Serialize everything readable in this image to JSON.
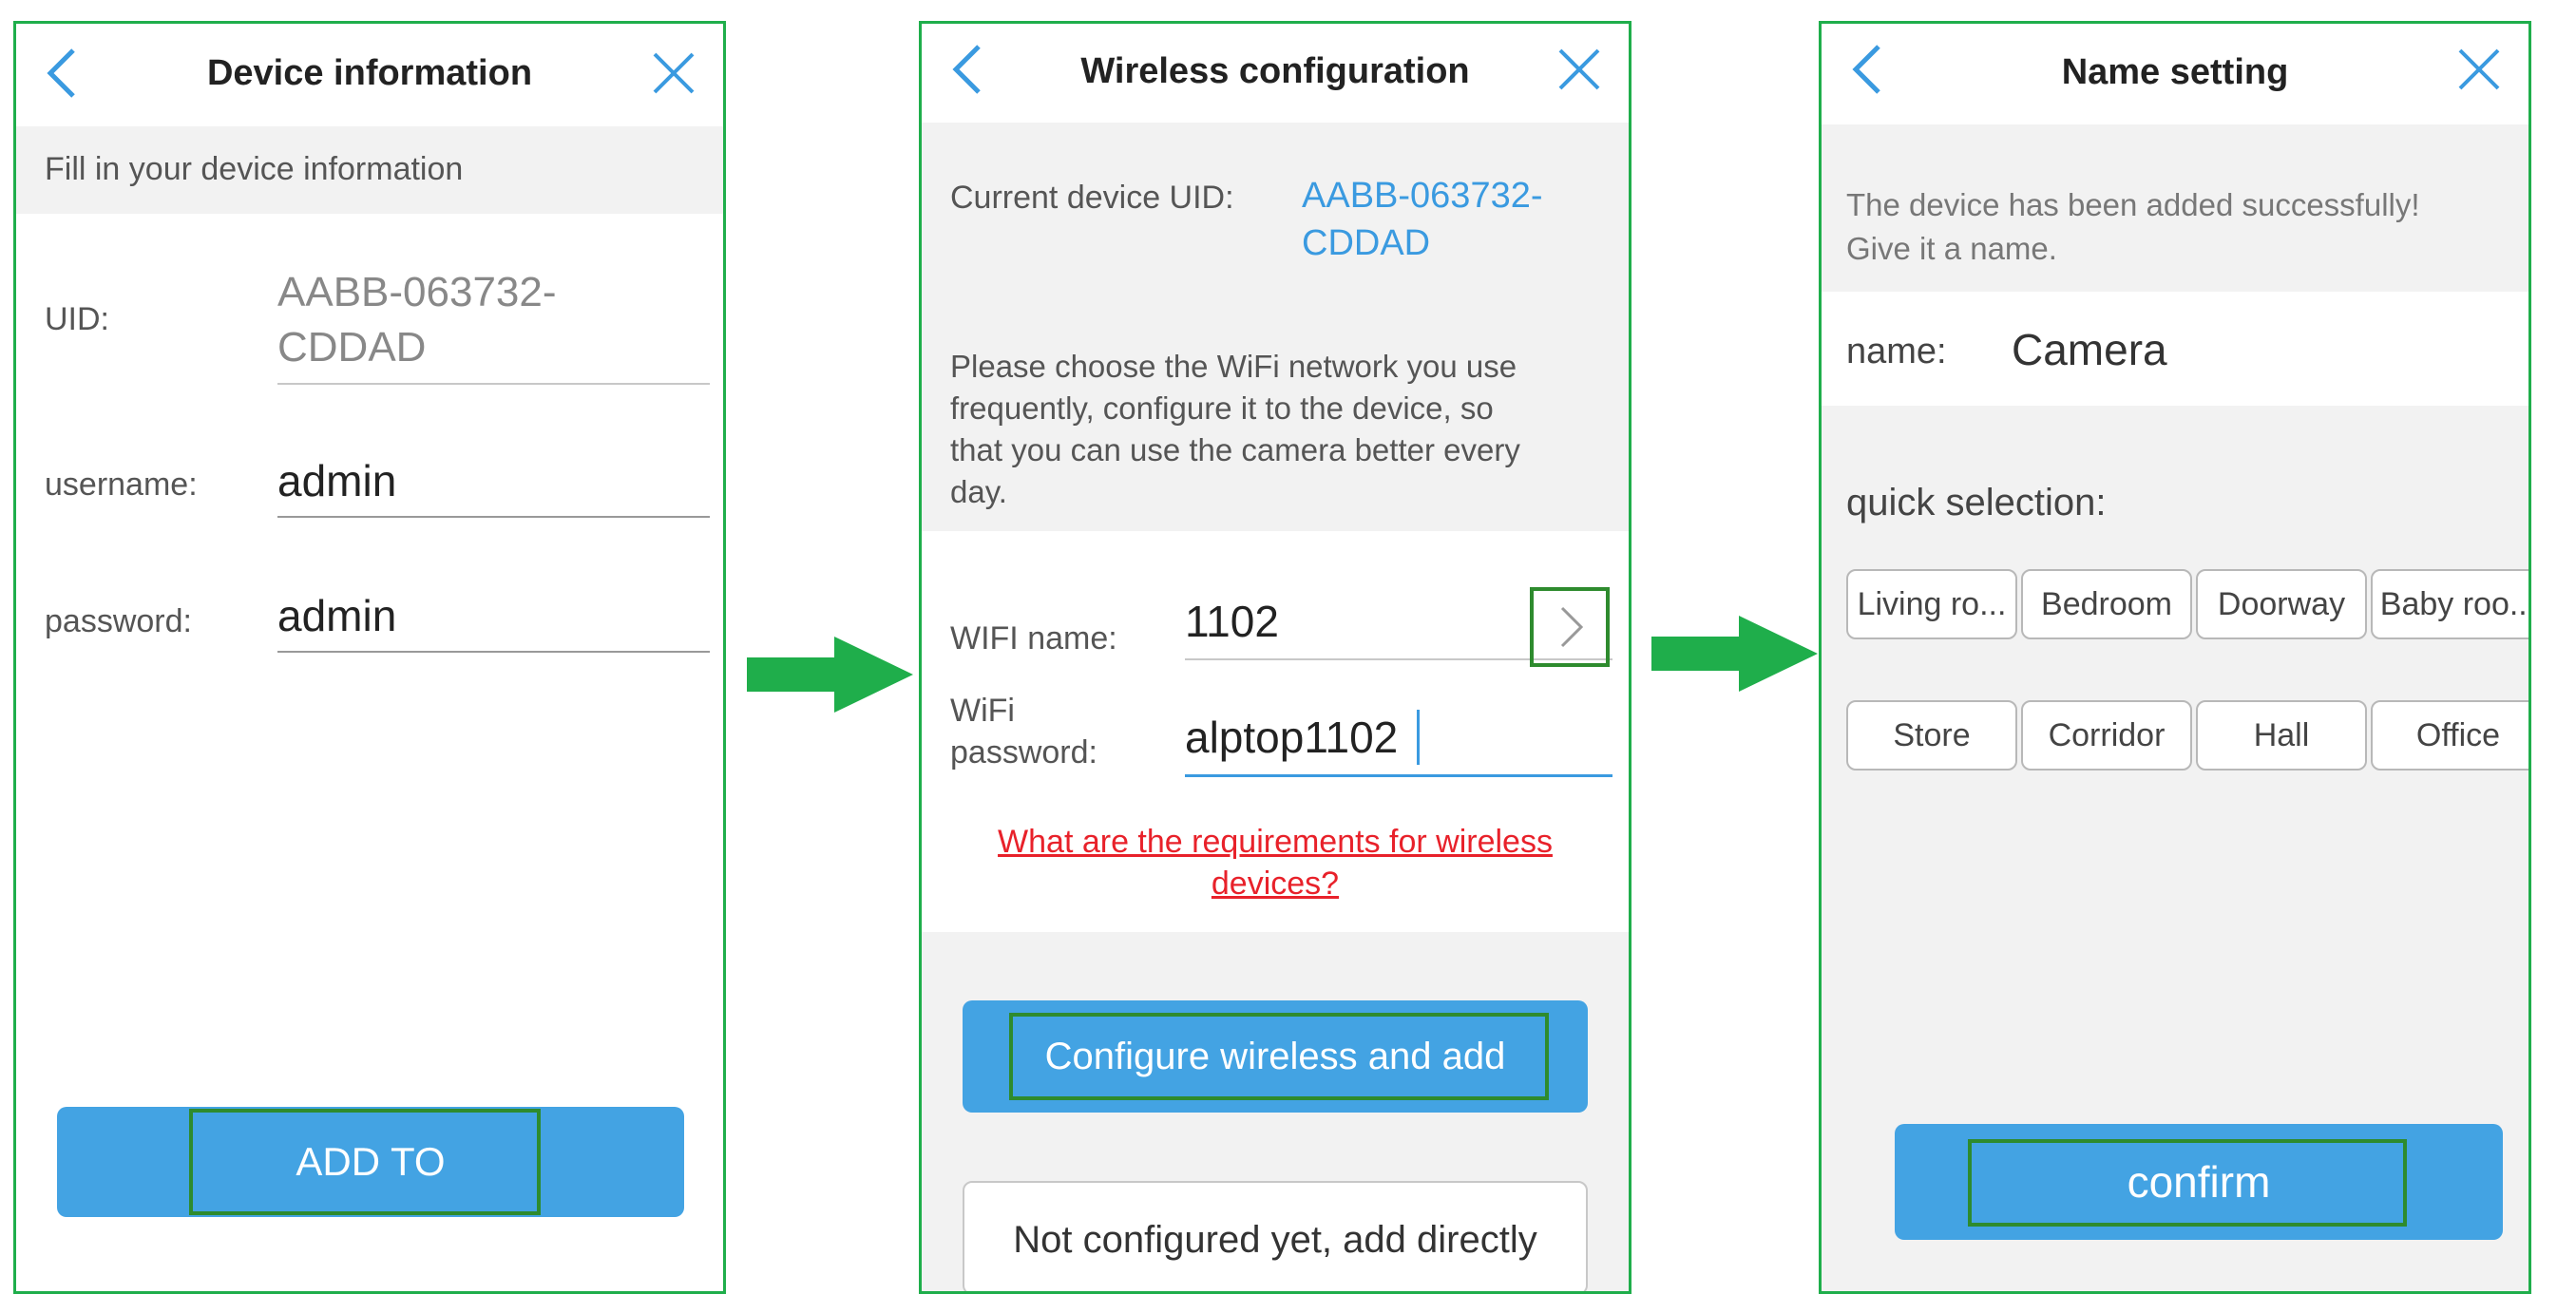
{
  "screen1": {
    "title": "Device information",
    "subtitle": "Fill in your device information",
    "uid_label": "UID:",
    "uid_value_line1": "AABB-063732-",
    "uid_value_line2": "CDDAD",
    "username_label": "username:",
    "username_value": "admin",
    "password_label": "password:",
    "password_value": "admin",
    "add_button": "ADD TO"
  },
  "screen2": {
    "title": "Wireless configuration",
    "uid_label": "Current device UID:",
    "uid_value_line1": "AABB-063732-",
    "uid_value_line2": "CDDAD",
    "instructions": [
      "Please choose the WiFi network you use",
      "frequently, configure it to the device, so",
      "that you can use the camera better every",
      "day."
    ],
    "wifi_name_label": "WIFI name:",
    "wifi_name_value": "1102",
    "wifi_password_label_line1": "WiFi",
    "wifi_password_label_line2": "password:",
    "wifi_password_value": "alptop1102",
    "requirements_link_line1": "What are the requirements for wireless",
    "requirements_link_line2": "devices?",
    "configure_button": "Configure wireless and add",
    "direct_add_button": "Not configured yet, add directly"
  },
  "screen3": {
    "title": "Name setting",
    "success_line1": "The device has been added successfully!",
    "success_line2": "Give it a name.",
    "name_label": "name:",
    "name_value": "Camera",
    "quick_label": "quick selection:",
    "quick_options": [
      "Living ro...",
      "Bedroom",
      "Doorway",
      "Baby roo...",
      "Store",
      "Corridor",
      "Hall",
      "Office"
    ],
    "confirm_button": "confirm"
  },
  "colors": {
    "accent_blue": "#43a3e3",
    "frame_green": "#1fae4b",
    "highlight_green": "#2e8b2e",
    "link_red": "#e8212a",
    "uid_blue": "#3a9ae0"
  }
}
